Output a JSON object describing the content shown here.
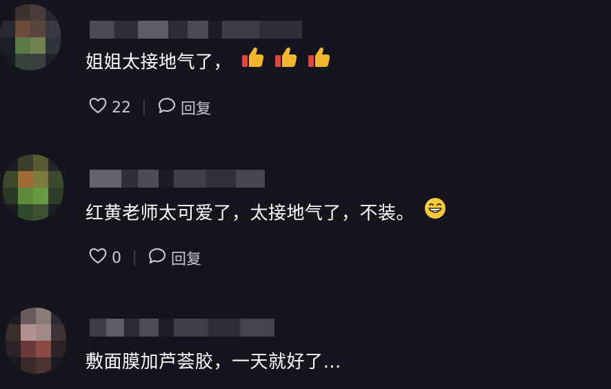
{
  "colors": {
    "background": "#14151d",
    "text": "#ffffff",
    "action_text": "#c7c8cf"
  },
  "comments": [
    {
      "text": "姐姐太接地气了，",
      "emoji": [
        "thumbs-up-icon",
        "thumbs-up-icon",
        "thumbs-up-icon"
      ],
      "likes": "22",
      "reply_label": "回复"
    },
    {
      "text": "红黄老师太可爱了，太接地气了，不装。",
      "emoji": [
        "grinning-face-icon"
      ],
      "likes": "0",
      "reply_label": "回复"
    },
    {
      "text": "敷面膜加芦荟胶，一天就好了…"
    }
  ]
}
